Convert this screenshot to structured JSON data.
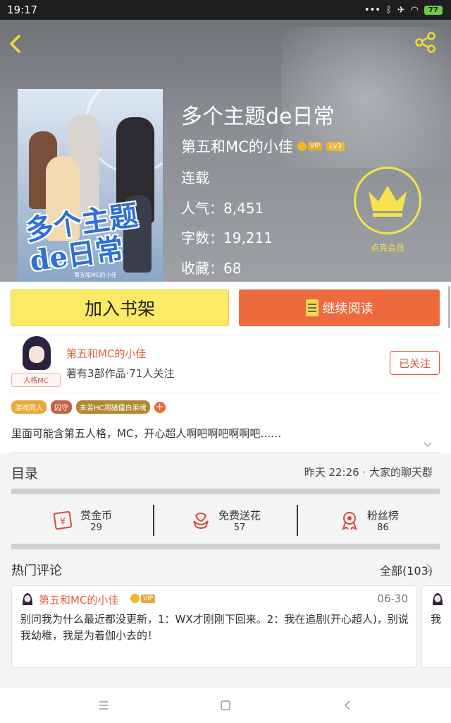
{
  "status": {
    "time": "19:17",
    "battery": "77"
  },
  "book": {
    "title": "多个主题de日常",
    "author": "第五和MC的小佳",
    "vip": "VIP",
    "level": "Lv3",
    "state": "连载",
    "popularity": "人气：8,451",
    "word_count": "字数：19,211",
    "favorites": "收藏：68",
    "cover_title": "多个主题\nde日常",
    "cover_subtitle": "第五和MC的小佳"
  },
  "member": {
    "label": "点亮会员"
  },
  "actions": {
    "add_shelf": "加入书架",
    "continue_read": "继续阅读"
  },
  "author_card": {
    "avatar_tag": "人格MC",
    "name": "第五和MC的小佳",
    "stats": "著有3部作品·71人关注",
    "follow": "已关注"
  },
  "tags": [
    "游戏同人",
    "囚守",
    "未苦HC凋猪僵白莱魂"
  ],
  "description": "里面可能含第五人格，MC，开心超人啊吧啊吧啊啊吧……",
  "toc": {
    "label": "目录",
    "latest": "昨天 22:26 · 大家的聊天群"
  },
  "stats": [
    {
      "label": "赏金币",
      "value": "29"
    },
    {
      "label": "免费送花",
      "value": "57"
    },
    {
      "label": "粉丝榜",
      "value": "86"
    }
  ],
  "comments_section": {
    "title": "热门评论",
    "all": "全部(103)"
  },
  "comment": {
    "name": "第五和MC的小佳",
    "vip": "VIP",
    "date": "06-30",
    "text": "别问我为什么最近都没更新，1：WX才刚刚下回来。2：我在追剧(开心超人)，别说我幼稚，我是为着伽小去的！",
    "next_preview": "我"
  },
  "colors": {
    "accent": "#ec6a3d",
    "shelf": "#fbea66",
    "member": "#f4e34a"
  }
}
